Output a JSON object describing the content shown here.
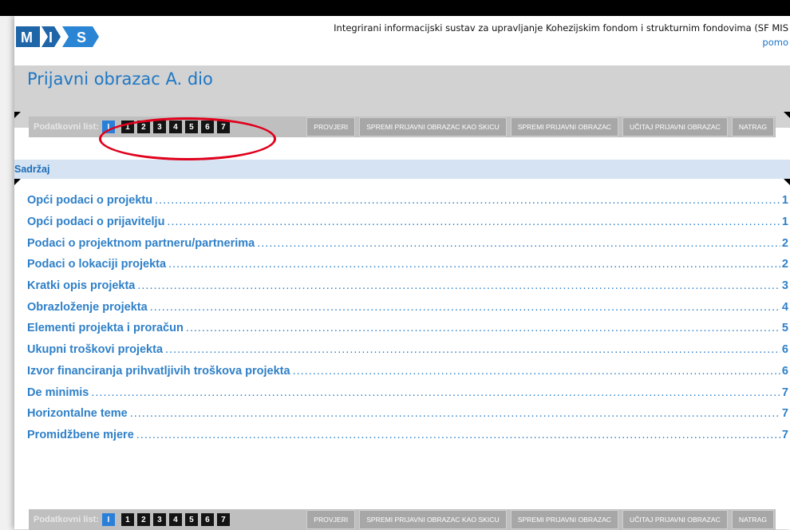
{
  "header": {
    "logo_text": "MIS",
    "app_title": "Integrirani informacijski sustav za upravljanje Kohezijskim fondom i strukturnim fondovima (SF MIS",
    "help_link": "pomo"
  },
  "page_title": "Prijavni obrazac A. dio",
  "toolbar": {
    "label": "Podatkovni list:",
    "sheets": [
      "I",
      "1",
      "2",
      "3",
      "4",
      "5",
      "6",
      "7"
    ],
    "active_sheet": "I",
    "actions": {
      "check": "PROVJERI",
      "save_draft": "SPREMI PRIJAVNI OBRAZAC KAO SKICU",
      "save": "SPREMI PRIJAVNI OBRAZAC",
      "load": "UČITAJ PRIJAVNI OBRAZAC",
      "back": "NATRAG"
    }
  },
  "section": {
    "title": "Sadržaj"
  },
  "toc": [
    {
      "title": "Opći podaci o projektu",
      "page": "1"
    },
    {
      "title": "Opći podaci o prijavitelju",
      "page": "1"
    },
    {
      "title": "Podaci o projektnom partneru/partnerima",
      "page": "2"
    },
    {
      "title": "Podaci o lokaciji projekta",
      "page": "2"
    },
    {
      "title": "Kratki opis projekta",
      "page": "3"
    },
    {
      "title": "Obrazloženje projekta",
      "page": "4"
    },
    {
      "title": "Elementi projekta i proračun",
      "page": "5"
    },
    {
      "title": "Ukupni troškovi projekta",
      "page": "6"
    },
    {
      "title": "Izvor financiranja prihvatljivih troškova projekta",
      "page": "6"
    },
    {
      "title": "De minimis",
      "page": "7"
    },
    {
      "title": "Horizontalne teme",
      "page": "7"
    },
    {
      "title": "Promidžbene mjere",
      "page": "7"
    }
  ],
  "colors": {
    "accent": "#1e77c4",
    "active_sheet": "#2a7fd8",
    "annotation": "#e0001b",
    "titlebar": "#d2d2d2",
    "section_header": "#d5e3f3"
  }
}
